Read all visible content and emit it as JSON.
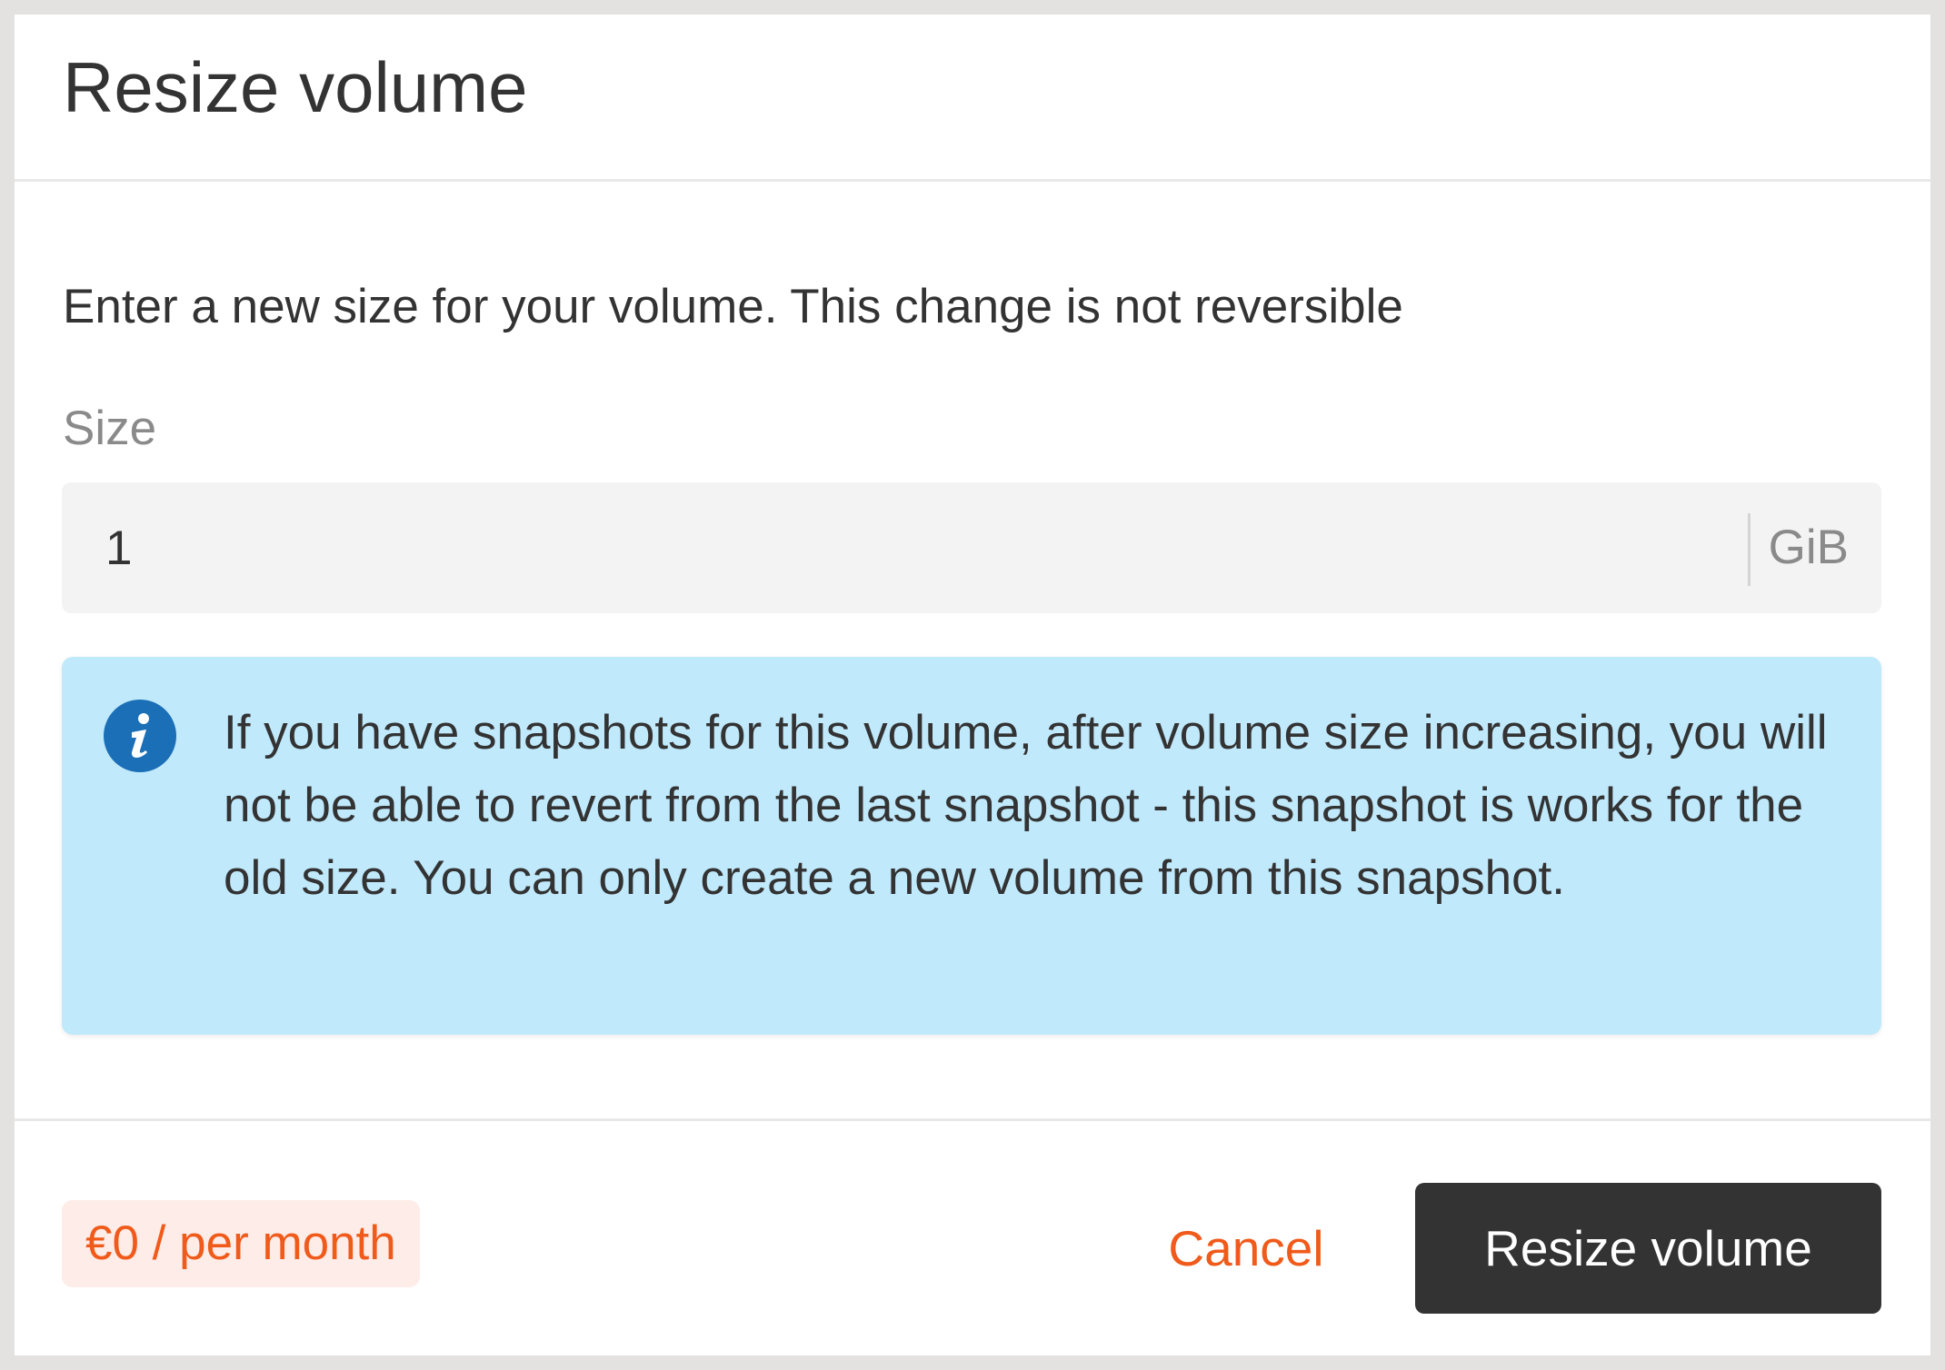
{
  "dialog": {
    "title": "Resize volume",
    "description": "Enter a new size for your volume. This change is not reversible",
    "size_field": {
      "label": "Size",
      "value": "1",
      "unit": "GiB"
    },
    "info": {
      "icon": "info-icon",
      "text": "If you have snapshots for this volume, after volume size increasing, you will not be able to revert from the last snapshot - this snapshot is works for the old size. You can only create a new volume from this snapshot."
    },
    "footer": {
      "price": "€0 / per month",
      "cancel_label": "Cancel",
      "submit_label": "Resize volume"
    }
  },
  "colors": {
    "accent": "#f05a1a",
    "info_background": "#c0e9fc",
    "info_icon": "#1b6fb7",
    "primary_button": "#333333",
    "price_badge_background": "#fdece7"
  }
}
